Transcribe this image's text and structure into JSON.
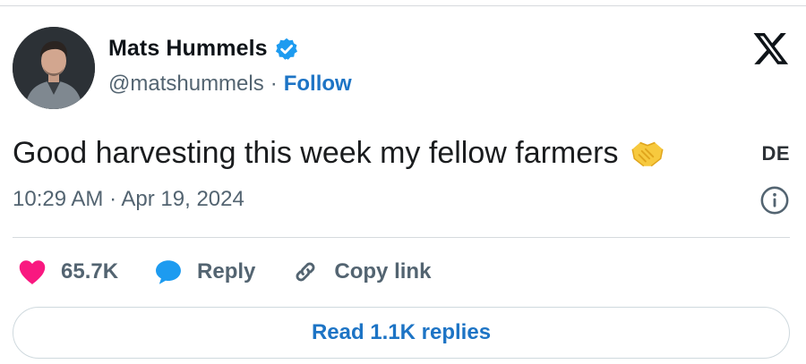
{
  "author": {
    "name": "Mats Hummels",
    "handle": "@matshummels",
    "separator": "·",
    "follow_label": "Follow",
    "verified_icon": "verified-badge-icon",
    "avatar": "profile-photo"
  },
  "brand": {
    "logo_icon": "x-logo-icon"
  },
  "tweet": {
    "text": "Good harvesting this week my fellow farmers",
    "emoji_icon": "handshake-icon",
    "language_badge": "DE",
    "timestamp": "10:29 AM · Apr 19, 2024"
  },
  "actions": {
    "likes_count": "65.7K",
    "reply_label": "Reply",
    "copy_link_label": "Copy link"
  },
  "footer": {
    "read_replies_label": "Read 1.1K replies"
  },
  "colors": {
    "link_blue": "#1d74c5",
    "verified_blue": "#1d9bf0",
    "heart_pink": "#f91880",
    "muted_text": "#536471",
    "divider": "#d6dadd"
  }
}
